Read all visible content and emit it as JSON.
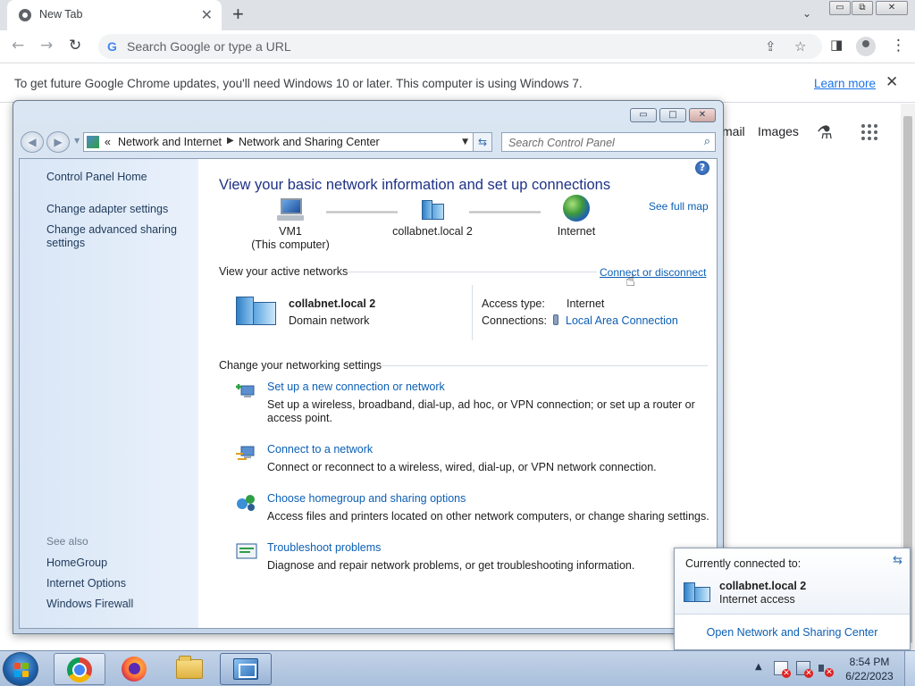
{
  "chrome": {
    "tab_title": "New Tab",
    "tab_close": "✕",
    "new_tab": "+",
    "omnibox_placeholder": "Search Google or type a URL",
    "g_letter": "G",
    "infobar_text": "To get future Google Chrome updates, you'll need Windows 10 or later. This computer is using Windows 7.",
    "infobar_link": "Learn more",
    "infobar_close": "✕",
    "ntp_links": [
      "mail",
      "Images"
    ]
  },
  "control_panel": {
    "breadcrumb": {
      "overflow": "«",
      "items": [
        "Network and Internet",
        "Network and Sharing Center"
      ]
    },
    "search_placeholder": "Search Control Panel",
    "sidebar": {
      "home": "Control Panel Home",
      "links": [
        "Change adapter settings",
        "Change advanced sharing settings"
      ],
      "see_also_label": "See also",
      "see_also": [
        "HomeGroup",
        "Internet Options",
        "Windows Firewall"
      ]
    },
    "main": {
      "title": "View your basic network information and set up connections",
      "see_full_map": "See full map",
      "map": {
        "computer_name": "VM1",
        "computer_sub": "(This computer)",
        "domain": "collabnet.local  2",
        "internet": "Internet"
      },
      "active_networks": {
        "heading": "View your active networks",
        "connect_link": "Connect or disconnect",
        "network_name": "collabnet.local  2",
        "network_type": "Domain network",
        "access_type_label": "Access type:",
        "access_type_value": "Internet",
        "connections_label": "Connections:",
        "connections_value": "Local Area Connection"
      },
      "settings": {
        "heading": "Change your networking settings",
        "tasks": [
          {
            "link": "Set up a new connection or network",
            "desc": "Set up a wireless, broadband, dial-up, ad hoc, or VPN connection; or set up a router or access point."
          },
          {
            "link": "Connect to a network",
            "desc": "Connect or reconnect to a wireless, wired, dial-up, or VPN network connection."
          },
          {
            "link": "Choose homegroup and sharing options",
            "desc": "Access files and printers located on other network computers, or change sharing settings."
          },
          {
            "link": "Troubleshoot problems",
            "desc": "Diagnose and repair network problems, or get troubleshooting information."
          }
        ]
      }
    }
  },
  "flyout": {
    "heading": "Currently connected to:",
    "network_name": "collabnet.local  2",
    "status": "Internet access",
    "open_link": "Open Network and Sharing Center"
  },
  "taskbar": {
    "time": "8:54 PM",
    "date": "6/22/2023"
  },
  "colors": {
    "link_blue": "#0b5fb5",
    "title_blue": "#1e3287",
    "chrome_accent": "#1a73e8"
  }
}
